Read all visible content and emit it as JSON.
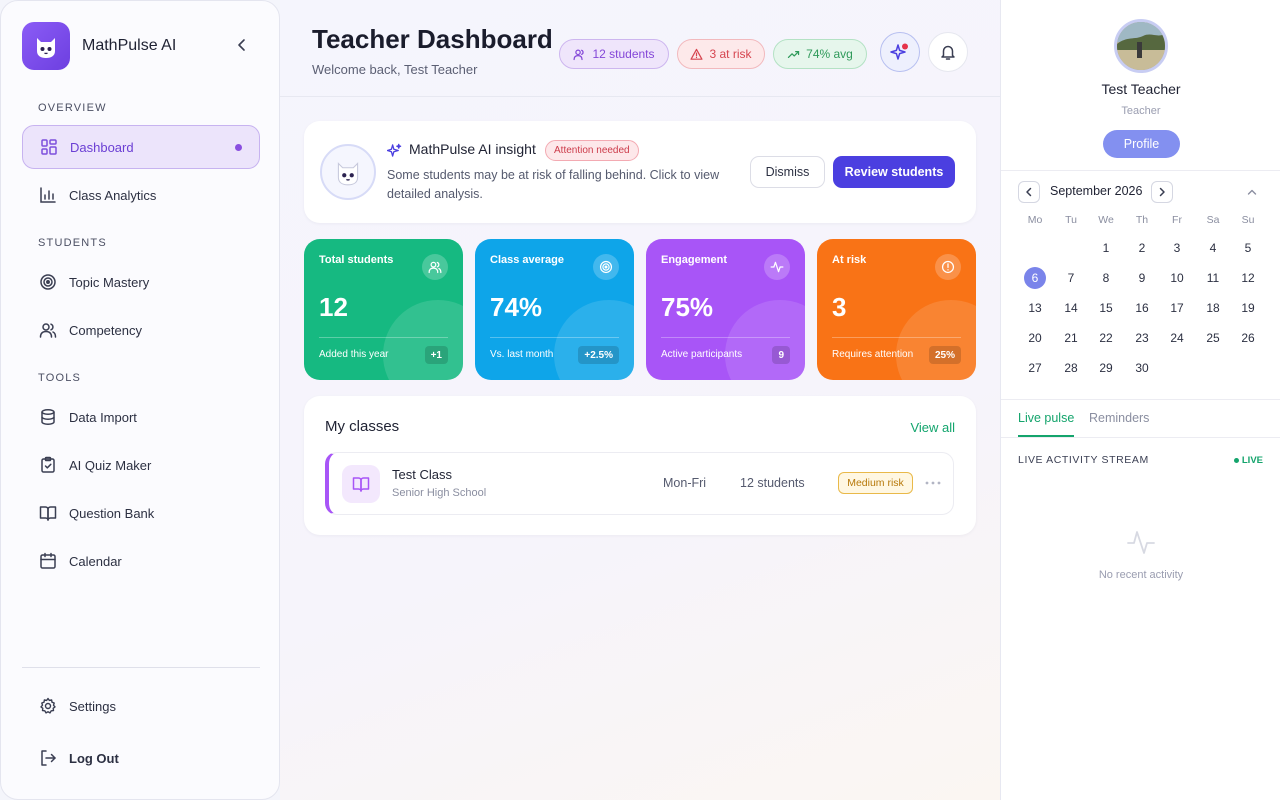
{
  "sidebar": {
    "brand": "MathPulse AI",
    "sections": {
      "overview": "OVERVIEW",
      "students": "STUDENTS",
      "tools": "TOOLS"
    },
    "items": [
      {
        "label": "Dashboard",
        "icon": "dashboard-icon",
        "active": true
      },
      {
        "label": "Class Analytics",
        "icon": "bar-chart-icon"
      },
      {
        "label": "Topic Mastery",
        "icon": "target-icon"
      },
      {
        "label": "Competency",
        "icon": "users-icon"
      },
      {
        "label": "Data Import",
        "icon": "database-icon"
      },
      {
        "label": "AI Quiz Maker",
        "icon": "clipboard-check-icon"
      },
      {
        "label": "Question Bank",
        "icon": "book-open-icon"
      },
      {
        "label": "Calendar",
        "icon": "calendar-icon"
      }
    ],
    "settings_label": "Settings",
    "logout_label": "Log Out"
  },
  "header": {
    "title": "Teacher Dashboard",
    "subtitle": "Welcome back, Test Teacher",
    "chips": {
      "students": "12 students",
      "risk": "3 at risk",
      "avg": "74% avg"
    }
  },
  "insight": {
    "title": "MathPulse AI insight",
    "badge": "Attention needed",
    "text": "Some students may be at risk of falling behind. Click to view detailed analysis.",
    "dismiss_label": "Dismiss",
    "review_label": "Review students"
  },
  "stats": [
    {
      "label": "Total students",
      "value": "12",
      "foot": "Added this year",
      "pill": "+1",
      "color": "#16b981"
    },
    {
      "label": "Class average",
      "value": "74%",
      "foot": "Vs. last month",
      "pill": "+2.5%",
      "color": "#0ea5e9"
    },
    {
      "label": "Engagement",
      "value": "75%",
      "foot": "Active participants",
      "pill": "9",
      "color": "#a855f7"
    },
    {
      "label": "At risk",
      "value": "3",
      "foot": "Requires attention",
      "pill": "25%",
      "color": "#f97316"
    }
  ],
  "classes": {
    "title": "My classes",
    "view_all": "View all",
    "rows": [
      {
        "name": "Test Class",
        "level": "Senior High School",
        "days": "Mon-Fri",
        "count": "12 students",
        "risk": "Medium risk"
      }
    ]
  },
  "profile": {
    "name": "Test Teacher",
    "role": "Teacher",
    "button": "Profile"
  },
  "calendar": {
    "month": "September 2026",
    "weekdays": [
      "Mo",
      "Tu",
      "We",
      "Th",
      "Fr",
      "Sa",
      "Su"
    ],
    "first_weekday_index": 2,
    "days_in_month": 30,
    "today": 6
  },
  "activity": {
    "tabs": [
      "Live pulse",
      "Reminders"
    ],
    "stream_title": "LIVE ACTIVITY STREAM",
    "live_label": "LIVE",
    "empty_text": "No recent activity"
  }
}
